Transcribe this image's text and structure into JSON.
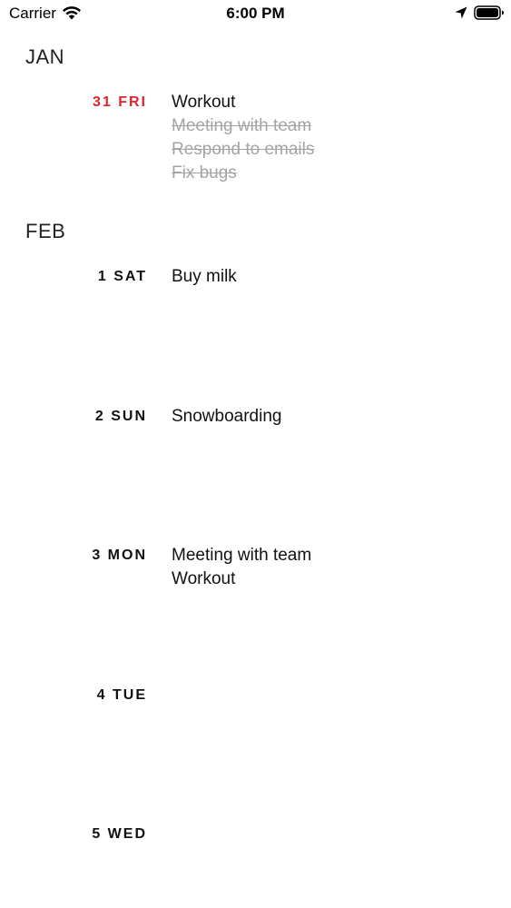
{
  "status_bar": {
    "carrier": "Carrier",
    "time": "6:00 PM",
    "icons": [
      "wifi-icon",
      "location-arrow-icon",
      "battery-icon"
    ]
  },
  "colors": {
    "today_accent": "#e0232b",
    "completed_task": "#a4a4a4",
    "text": "#111111"
  },
  "months": [
    {
      "name": "JAN",
      "days": [
        {
          "label": "31 FRI",
          "is_today": true,
          "tasks": [
            {
              "title": "Workout",
              "completed": false
            },
            {
              "title": "Meeting with team",
              "completed": true
            },
            {
              "title": "Respond to emails",
              "completed": true
            },
            {
              "title": "Fix bugs",
              "completed": true
            }
          ]
        }
      ]
    },
    {
      "name": "FEB",
      "days": [
        {
          "label": "1 SAT",
          "is_today": false,
          "tasks": [
            {
              "title": "Buy milk",
              "completed": false
            }
          ]
        },
        {
          "label": "2 SUN",
          "is_today": false,
          "tasks": [
            {
              "title": "Snowboarding",
              "completed": false
            }
          ]
        },
        {
          "label": "3 MON",
          "is_today": false,
          "tasks": [
            {
              "title": "Meeting with team",
              "completed": false
            },
            {
              "title": "Workout",
              "completed": false
            }
          ]
        },
        {
          "label": "4 TUE",
          "is_today": false,
          "tasks": []
        },
        {
          "label": "5 WED",
          "is_today": false,
          "tasks": []
        }
      ]
    }
  ]
}
